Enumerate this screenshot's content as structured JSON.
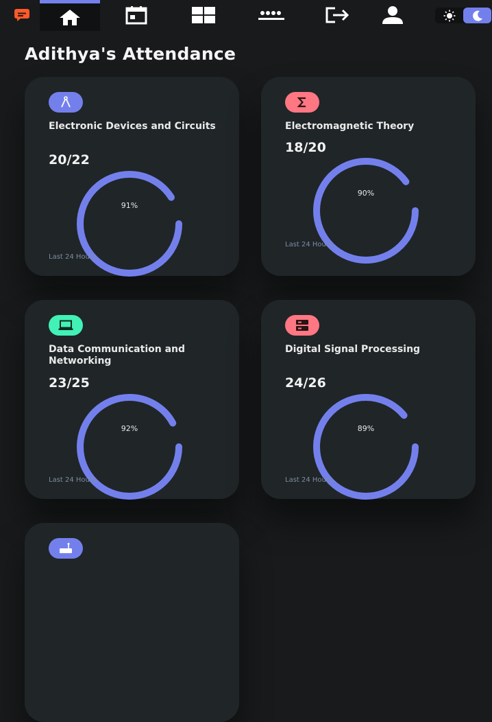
{
  "nav": {
    "items": [
      {
        "name": "home",
        "icon": "home-icon"
      },
      {
        "name": "timetable",
        "icon": "calendar-icon"
      },
      {
        "name": "dashboard",
        "icon": "grid-icon"
      },
      {
        "name": "password",
        "icon": "password-icon"
      },
      {
        "name": "logout",
        "icon": "logout-icon"
      },
      {
        "name": "profile",
        "icon": "person-icon"
      }
    ],
    "theme": {
      "light_icon": "sun-icon",
      "dark_icon": "moon-icon",
      "active": "dark"
    }
  },
  "page": {
    "title": "Adithya's Attendance"
  },
  "colors": {
    "accent": "#7380ec",
    "danger": "#ff7782",
    "success": "#41f1b6"
  },
  "subjects": [
    {
      "name": "Electronic Devices and Circuits",
      "count": "20/22",
      "percent_label": "91%",
      "percent": 91,
      "footer": "Last 24 Hours",
      "icon": "compass-icon",
      "color": "#7380ec"
    },
    {
      "name": "Electromagnetic Theory",
      "count": "18/20",
      "percent_label": "90%",
      "percent": 90,
      "footer": "Last 24 Hours",
      "icon": "sigma-icon",
      "color": "#ff7782"
    },
    {
      "name": "Data Communication and Networking",
      "count": "23/25",
      "percent_label": "92%",
      "percent": 92,
      "footer": "Last 24 Hours",
      "icon": "laptop-icon",
      "color": "#41f1b6"
    },
    {
      "name": "Digital Signal Processing",
      "count": "24/26",
      "percent_label": "89%",
      "percent": 89,
      "footer": "Last 24 Hours",
      "icon": "storage-icon",
      "color": "#ff7782"
    },
    {
      "icon": "router-icon",
      "color": "#7380ec"
    }
  ]
}
